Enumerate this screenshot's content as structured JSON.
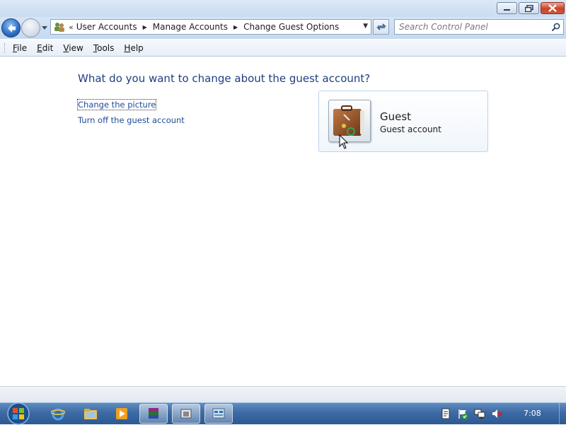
{
  "address_bar": {
    "overflow_chevron": "«",
    "breadcrumbs": [
      "User Accounts",
      "Manage Accounts",
      "Change Guest Options"
    ]
  },
  "search": {
    "placeholder": "Search Control Panel"
  },
  "menu": {
    "items": [
      {
        "label": "File",
        "accel": "F",
        "rest": "ile"
      },
      {
        "label": "Edit",
        "accel": "E",
        "rest": "dit"
      },
      {
        "label": "View",
        "accel": "V",
        "rest": "iew"
      },
      {
        "label": "Tools",
        "accel": "T",
        "rest": "ools"
      },
      {
        "label": "Help",
        "accel": "H",
        "rest": "elp"
      }
    ]
  },
  "content": {
    "heading": "What do you want to change about the guest account?",
    "links": [
      "Change the picture",
      "Turn off the guest account"
    ],
    "account": {
      "name": "Guest",
      "type": "Guest account"
    }
  },
  "taskbar": {
    "clock": "7:08",
    "pinned": [
      "internet-explorer",
      "windows-explorer",
      "media-player",
      "winrar",
      "window-2",
      "control-panel"
    ],
    "active_index": 5
  },
  "colors": {
    "heading": "#1e3f80",
    "link": "#1e4c96",
    "taskbar": "#3d6aa4"
  }
}
